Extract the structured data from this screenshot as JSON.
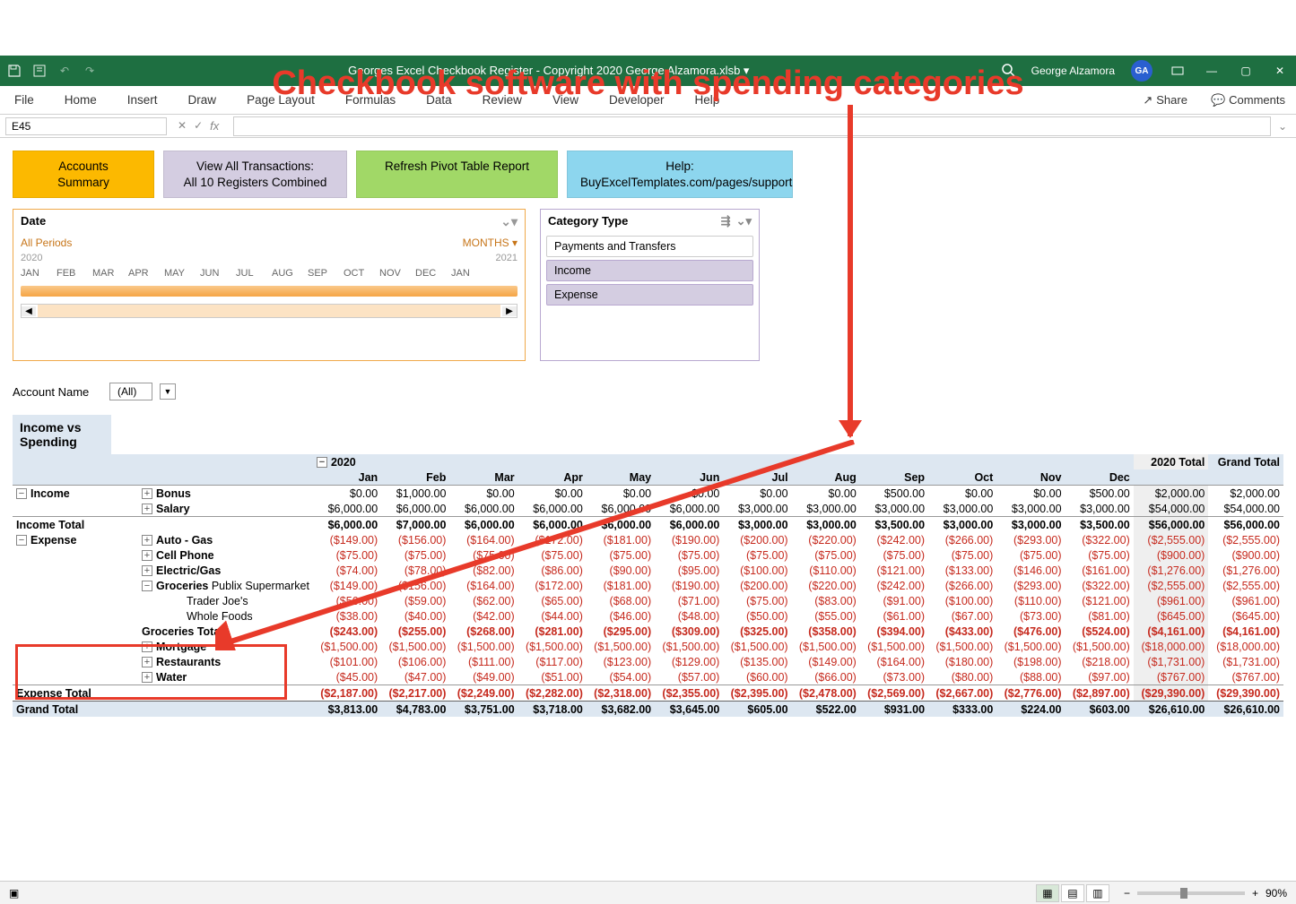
{
  "annotation": {
    "title": "Checkbook software with spending categories"
  },
  "titlebar": {
    "title": "Georges Excel Checkbook Register -  Copyright 2020 George Alzamora.xlsb",
    "user_name": "George Alzamora",
    "user_initials": "GA"
  },
  "ribbon": {
    "tabs": [
      "File",
      "Home",
      "Insert",
      "Draw",
      "Page Layout",
      "Formulas",
      "Data",
      "Review",
      "View",
      "Developer",
      "Help"
    ],
    "share": "Share",
    "comments": "Comments"
  },
  "formulabar": {
    "namebox": "E45",
    "fx": "fx"
  },
  "buttons": {
    "yellow": "Accounts\nSummary",
    "purple": "View All Transactions:\nAll 10 Registers Combined",
    "green": "Refresh Pivot Table Report",
    "blue": "Help:\nBuyExcelTemplates.com/pages/support"
  },
  "date_slicer": {
    "title": "Date",
    "all_periods": "All Periods",
    "months_label": "MONTHS",
    "year_left": "2020",
    "year_right": "2021",
    "months": [
      "JAN",
      "FEB",
      "MAR",
      "APR",
      "MAY",
      "JUN",
      "JUL",
      "AUG",
      "SEP",
      "OCT",
      "NOV",
      "DEC",
      "JAN"
    ]
  },
  "cat_slicer": {
    "title": "Category Type",
    "items": [
      "Payments and Transfers",
      "Income",
      "Expense"
    ]
  },
  "filter": {
    "label": "Account Name",
    "value": "(All)"
  },
  "pivot": {
    "title": "Income vs Spending",
    "year": "2020",
    "month_cols": [
      "Jan",
      "Feb",
      "Mar",
      "Apr",
      "May",
      "Jun",
      "Jul",
      "Aug",
      "Sep",
      "Oct",
      "Nov",
      "Dec"
    ],
    "total_col": "2020 Total",
    "grand_col": "Grand Total",
    "income_label": "Income",
    "bonus": {
      "label": "Bonus",
      "vals": [
        "$0.00",
        "$1,000.00",
        "$0.00",
        "$0.00",
        "$0.00",
        "$0.00",
        "$0.00",
        "$0.00",
        "$500.00",
        "$0.00",
        "$0.00",
        "$500.00"
      ],
      "total": "$2,000.00",
      "grand": "$2,000.00"
    },
    "salary": {
      "label": "Salary",
      "vals": [
        "$6,000.00",
        "$6,000.00",
        "$6,000.00",
        "$6,000.00",
        "$6,000.00",
        "$6,000.00",
        "$3,000.00",
        "$3,000.00",
        "$3,000.00",
        "$3,000.00",
        "$3,000.00",
        "$3,000.00"
      ],
      "total": "$54,000.00",
      "grand": "$54,000.00"
    },
    "income_total": {
      "label": "Income Total",
      "vals": [
        "$6,000.00",
        "$7,000.00",
        "$6,000.00",
        "$6,000.00",
        "$6,000.00",
        "$6,000.00",
        "$3,000.00",
        "$3,000.00",
        "$3,500.00",
        "$3,000.00",
        "$3,000.00",
        "$3,500.00"
      ],
      "total": "$56,000.00",
      "grand": "$56,000.00"
    },
    "expense_label": "Expense",
    "autogas": {
      "label": "Auto - Gas",
      "vals": [
        "($149.00)",
        "($156.00)",
        "($164.00)",
        "($172.00)",
        "($181.00)",
        "($190.00)",
        "($200.00)",
        "($220.00)",
        "($242.00)",
        "($266.00)",
        "($293.00)",
        "($322.00)"
      ],
      "total": "($2,555.00)",
      "grand": "($2,555.00)"
    },
    "cellphone": {
      "label": "Cell Phone",
      "vals": [
        "($75.00)",
        "($75.00)",
        "($75.00)",
        "($75.00)",
        "($75.00)",
        "($75.00)",
        "($75.00)",
        "($75.00)",
        "($75.00)",
        "($75.00)",
        "($75.00)",
        "($75.00)"
      ],
      "total": "($900.00)",
      "grand": "($900.00)"
    },
    "electric": {
      "label": "Electric/Gas",
      "vals": [
        "($74.00)",
        "($78.00)",
        "($82.00)",
        "($86.00)",
        "($90.00)",
        "($95.00)",
        "($100.00)",
        "($110.00)",
        "($121.00)",
        "($133.00)",
        "($146.00)",
        "($161.00)"
      ],
      "total": "($1,276.00)",
      "grand": "($1,276.00)"
    },
    "groceries": {
      "label": "Groceries"
    },
    "publix": {
      "label": "Publix Supermarket",
      "vals": [
        "($149.00)",
        "($156.00)",
        "($164.00)",
        "($172.00)",
        "($181.00)",
        "($190.00)",
        "($200.00)",
        "($220.00)",
        "($242.00)",
        "($266.00)",
        "($293.00)",
        "($322.00)"
      ],
      "total": "($2,555.00)",
      "grand": "($2,555.00)"
    },
    "traderjoes": {
      "label": "Trader Joe's",
      "vals": [
        "($56.00)",
        "($59.00)",
        "($62.00)",
        "($65.00)",
        "($68.00)",
        "($71.00)",
        "($75.00)",
        "($83.00)",
        "($91.00)",
        "($100.00)",
        "($110.00)",
        "($121.00)"
      ],
      "total": "($961.00)",
      "grand": "($961.00)"
    },
    "wholefoods": {
      "label": "Whole Foods",
      "vals": [
        "($38.00)",
        "($40.00)",
        "($42.00)",
        "($44.00)",
        "($46.00)",
        "($48.00)",
        "($50.00)",
        "($55.00)",
        "($61.00)",
        "($67.00)",
        "($73.00)",
        "($81.00)"
      ],
      "total": "($645.00)",
      "grand": "($645.00)"
    },
    "groceries_total": {
      "label": "Groceries Total",
      "vals": [
        "($243.00)",
        "($255.00)",
        "($268.00)",
        "($281.00)",
        "($295.00)",
        "($309.00)",
        "($325.00)",
        "($358.00)",
        "($394.00)",
        "($433.00)",
        "($476.00)",
        "($524.00)"
      ],
      "total": "($4,161.00)",
      "grand": "($4,161.00)"
    },
    "mortgage": {
      "label": "Mortgage",
      "vals": [
        "($1,500.00)",
        "($1,500.00)",
        "($1,500.00)",
        "($1,500.00)",
        "($1,500.00)",
        "($1,500.00)",
        "($1,500.00)",
        "($1,500.00)",
        "($1,500.00)",
        "($1,500.00)",
        "($1,500.00)",
        "($1,500.00)"
      ],
      "total": "($18,000.00)",
      "grand": "($18,000.00)"
    },
    "restaurants": {
      "label": "Restaurants",
      "vals": [
        "($101.00)",
        "($106.00)",
        "($111.00)",
        "($117.00)",
        "($123.00)",
        "($129.00)",
        "($135.00)",
        "($149.00)",
        "($164.00)",
        "($180.00)",
        "($198.00)",
        "($218.00)"
      ],
      "total": "($1,731.00)",
      "grand": "($1,731.00)"
    },
    "water": {
      "label": "Water",
      "vals": [
        "($45.00)",
        "($47.00)",
        "($49.00)",
        "($51.00)",
        "($54.00)",
        "($57.00)",
        "($60.00)",
        "($66.00)",
        "($73.00)",
        "($80.00)",
        "($88.00)",
        "($97.00)"
      ],
      "total": "($767.00)",
      "grand": "($767.00)"
    },
    "expense_total": {
      "label": "Expense Total",
      "vals": [
        "($2,187.00)",
        "($2,217.00)",
        "($2,249.00)",
        "($2,282.00)",
        "($2,318.00)",
        "($2,355.00)",
        "($2,395.00)",
        "($2,478.00)",
        "($2,569.00)",
        "($2,667.00)",
        "($2,776.00)",
        "($2,897.00)"
      ],
      "total": "($29,390.00)",
      "grand": "($29,390.00)"
    },
    "grand_total": {
      "label": "Grand Total",
      "vals": [
        "$3,813.00",
        "$4,783.00",
        "$3,751.00",
        "$3,718.00",
        "$3,682.00",
        "$3,645.00",
        "$605.00",
        "$522.00",
        "$931.00",
        "$333.00",
        "$224.00",
        "$603.00"
      ],
      "total": "$26,610.00",
      "grand": "$26,610.00"
    }
  },
  "statusbar": {
    "zoom": "90%"
  }
}
